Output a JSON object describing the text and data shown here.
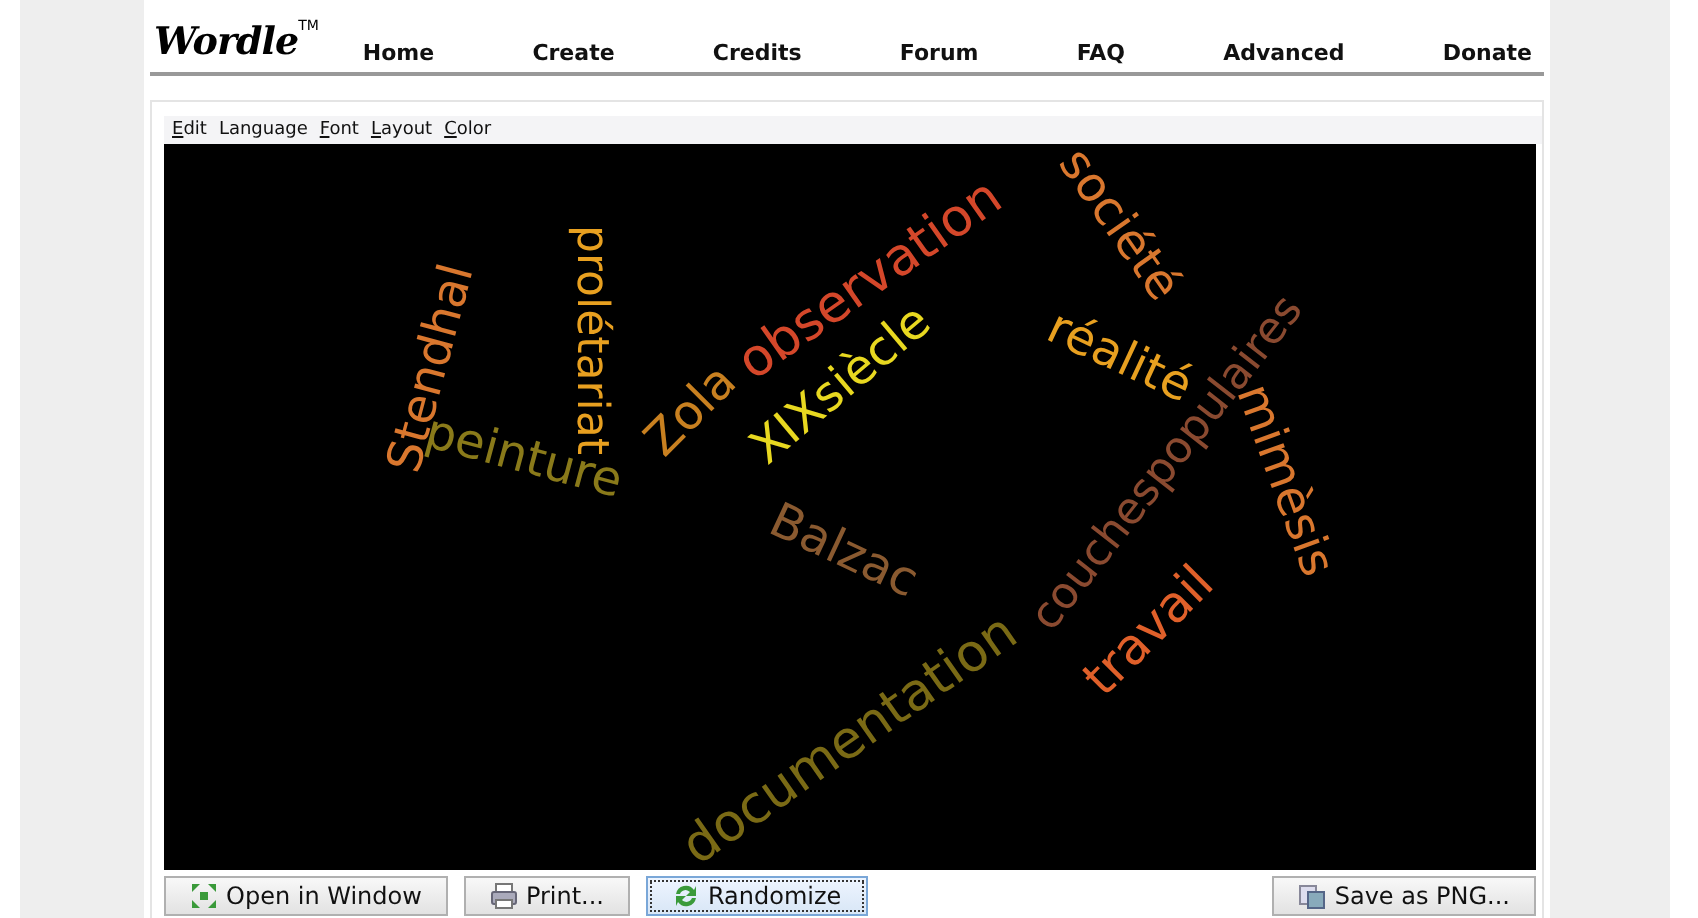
{
  "logo": {
    "text": "Wordle",
    "mark": "TM"
  },
  "nav": [
    "Home",
    "Create",
    "Credits",
    "Forum",
    "FAQ",
    "Advanced",
    "Donate"
  ],
  "menu": [
    {
      "label": "Edit",
      "kind": "mnemonic"
    },
    {
      "label": "Language",
      "kind": "plain"
    },
    {
      "label": "Font",
      "kind": "mnemonic"
    },
    {
      "label": "Layout",
      "kind": "mnemonic"
    },
    {
      "label": "Color",
      "kind": "mnemonic"
    }
  ],
  "words": [
    {
      "text": "Stendhal",
      "color": "#d9772e"
    },
    {
      "text": "prolétariat",
      "color": "#e8a020"
    },
    {
      "text": "peinture",
      "color": "#8a7a1a"
    },
    {
      "text": "Zola",
      "color": "#c88020"
    },
    {
      "text": "observation",
      "color": "#d4472a"
    },
    {
      "text": "XIXsiècle",
      "color": "#e8d820"
    },
    {
      "text": "société",
      "color": "#d9772e"
    },
    {
      "text": "réalité",
      "color": "#e8a020"
    },
    {
      "text": "couchespopulaires",
      "color": "#8a4a30"
    },
    {
      "text": "mimèsis",
      "color": "#d9772e"
    },
    {
      "text": "Balzac",
      "color": "#8a5a30"
    },
    {
      "text": "travail",
      "color": "#e0602a"
    },
    {
      "text": "documentation",
      "color": "#7a6a15"
    }
  ],
  "buttons": [
    {
      "label": "Open in Window",
      "kind": "expand",
      "focused": false
    },
    {
      "label": "Print...",
      "kind": "printer",
      "focused": false
    },
    {
      "label": "Randomize",
      "kind": "refresh",
      "focused": true
    },
    {
      "label": "Save as PNG...",
      "kind": "save",
      "focused": false
    }
  ]
}
